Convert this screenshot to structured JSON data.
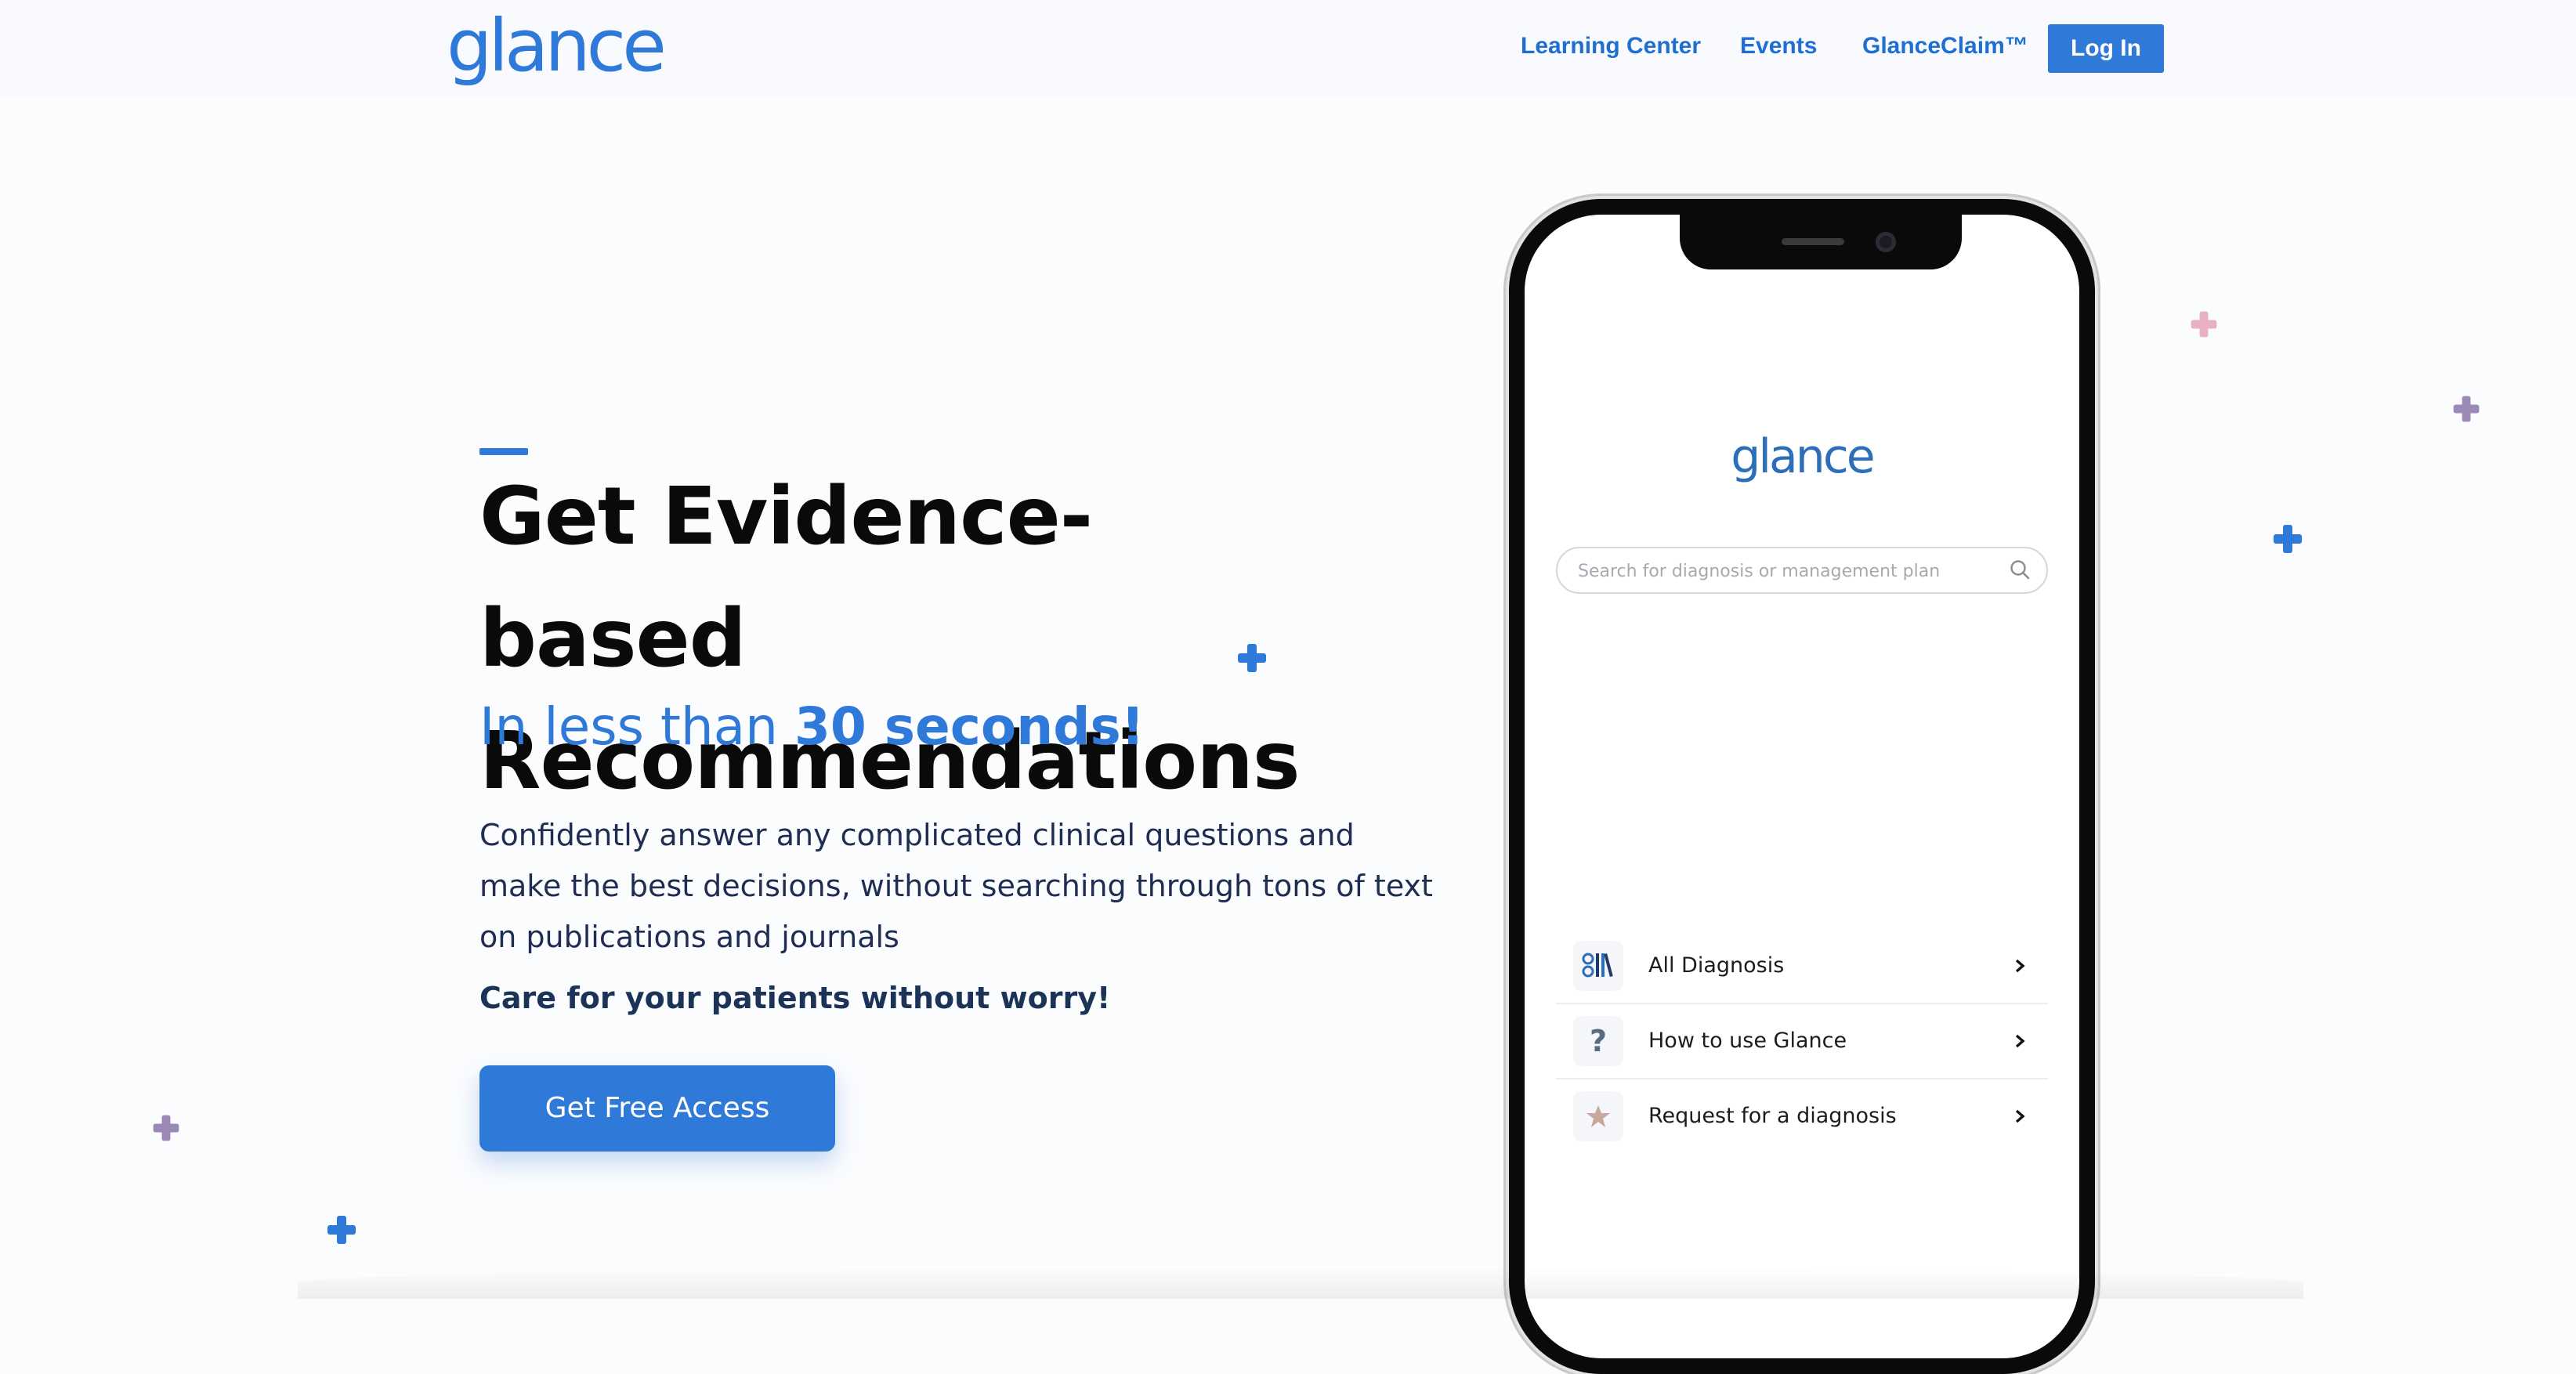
{
  "nav": {
    "logo": "glance",
    "links": [
      {
        "label": "Learning Center"
      },
      {
        "label": "Events"
      },
      {
        "label": "GlanceClaim™"
      }
    ],
    "login_label": "Log In"
  },
  "hero": {
    "headline_line1": "Get Evidence-based",
    "headline_line2": "Recommendations",
    "subhead_prefix": "In less than",
    "subhead_emphasis": "30 seconds!",
    "description": "Confidently answer any complicated clinical questions and make the best decisions, without searching through tons of text on publications and journals",
    "tagline": "Care for your patients without worry!",
    "cta_label": "Get Free Access"
  },
  "phone_app": {
    "logo": "glance",
    "search_placeholder": "Search for diagnosis or management plan",
    "menu": [
      {
        "label": "All Diagnosis",
        "icon": "books-icon"
      },
      {
        "label": "How to use Glance",
        "icon": "question-icon"
      },
      {
        "label": "Request for a diagnosis",
        "icon": "star-icon"
      }
    ]
  },
  "colors": {
    "brand_blue": "#2f79d8",
    "headline": "#0a0a0a",
    "body_text": "#1f2d52"
  }
}
